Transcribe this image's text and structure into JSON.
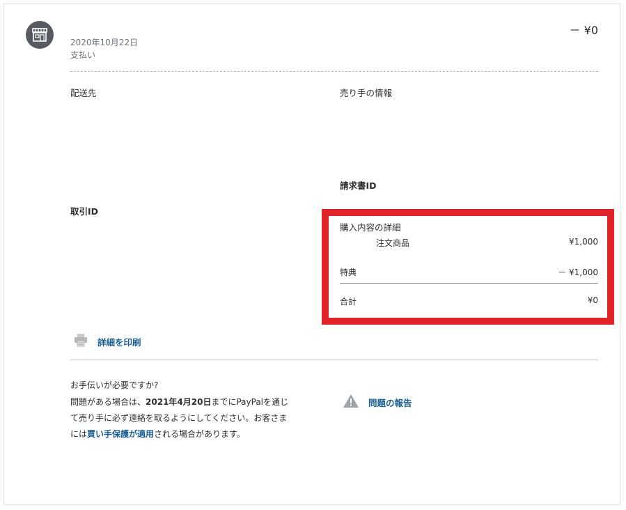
{
  "header": {
    "date": "2020年10月22日",
    "transaction_type": "支払い",
    "amount": "－ ¥0",
    "merchant_icon": "store-icon"
  },
  "details": {
    "shipping_label": "配送先",
    "seller_info_label": "売り手の情報",
    "invoice_id_label": "請求書ID",
    "transaction_id_label": "取引ID"
  },
  "purchase": {
    "title": "購入内容の詳細",
    "item_label": "注文商品",
    "item_amount": "¥1,000",
    "discount_label": "特典",
    "discount_amount": "－ ¥1,000",
    "total_label": "合計",
    "total_amount": "¥0"
  },
  "colors": {
    "highlight": "#e2232a",
    "link": "#1a5f94"
  },
  "print": {
    "label": "詳細を印刷",
    "icon": "printer-icon"
  },
  "help": {
    "title": "お手伝いが必要ですか?",
    "text_1": "問題がある場合は、",
    "deadline": "2021年4月20日",
    "text_2": "までにPayPalを通じて売り手に必ず連絡を取るようにしてください。お客さまには",
    "protection_link": "買い手保護が適用",
    "text_3": "される場合があります。"
  },
  "report": {
    "label": "問題の報告",
    "icon": "warning-icon"
  }
}
